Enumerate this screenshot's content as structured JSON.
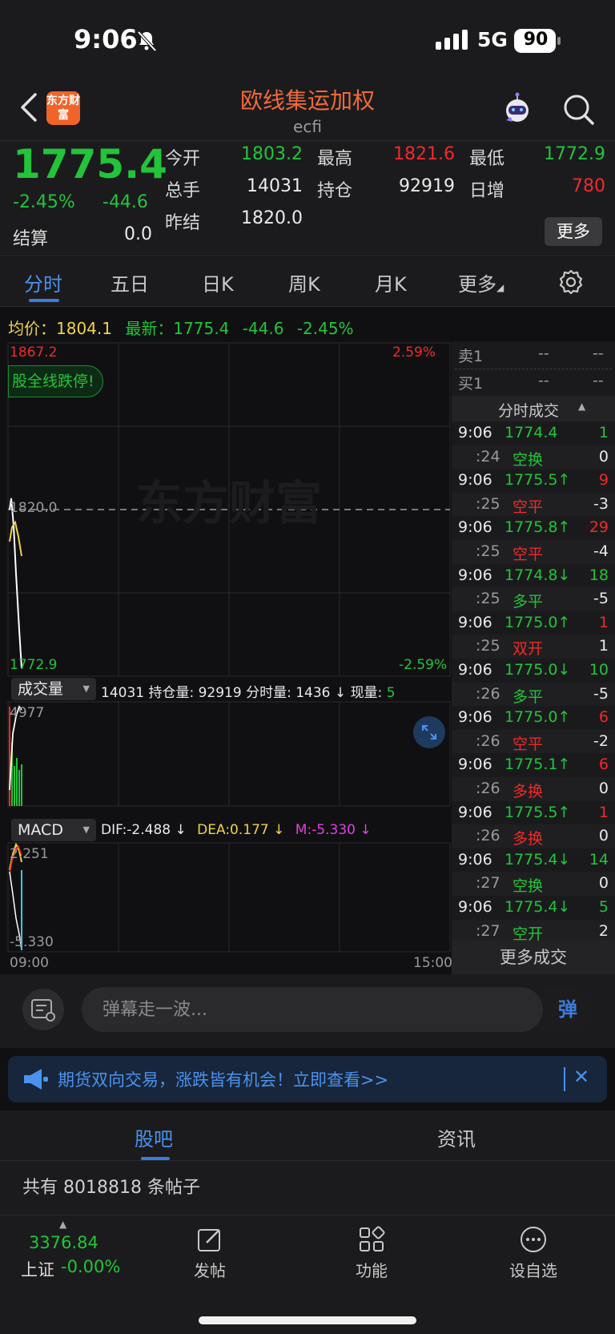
{
  "status": {
    "time": "9:06",
    "network": "5G",
    "battery": "90"
  },
  "header": {
    "title": "欧线集运加权",
    "subtitle": "ecfi",
    "logo_text": "东方财富"
  },
  "quote": {
    "price": "1775.4",
    "change_pct": "-2.45%",
    "change_abs": "-44.6",
    "settle_label": "结算",
    "settle_value": "0.0",
    "open_label": "今开",
    "open_value": "1803.2",
    "volume_label": "总手",
    "volume_value": "14031",
    "prev_settle_label": "昨结",
    "prev_settle_value": "1820.0",
    "high_label": "最高",
    "high_value": "1821.6",
    "oi_label": "持仓",
    "oi_value": "92919",
    "low_label": "最低",
    "low_value": "1772.9",
    "daily_inc_label": "日增",
    "daily_inc_value": "780",
    "more_label": "更多"
  },
  "tabs": [
    "分时",
    "五日",
    "日K",
    "周K",
    "月K",
    "更多"
  ],
  "infoline": {
    "avg_label": "均价：",
    "avg_value": "1804.1",
    "latest_label": "最新：",
    "latest_value": "1775.4",
    "latest_chg": "-44.6",
    "latest_pct": "-2.45%"
  },
  "chart": {
    "price_high": "1867.2",
    "price_mid": "1820.0",
    "price_low": "1772.9",
    "pct_high": "2.59%",
    "pct_low": "-2.59%",
    "watermark": "东方财富",
    "bubble": "股全线跌停!",
    "vol_selector": "成交量",
    "vol_info_1": "14031 持仓量: 92919 分时量: 1436",
    "vol_info_arrow": "↓",
    "vol_info_2": "现量:",
    "vol_info_cur": "5",
    "vol_max": "4977",
    "macd_selector": "MACD",
    "dif": "DIF:-2.488 ↓",
    "dea": "DEA:0.177 ↓",
    "m": "M:-5.330 ↓",
    "macd_high": "2.251",
    "macd_low": "-5.330",
    "time_start": "09:00",
    "time_end": "15:00"
  },
  "book": [
    {
      "label": "卖1",
      "price": "--",
      "vol": "--"
    },
    {
      "label": "买1",
      "price": "--",
      "vol": "--"
    }
  ],
  "trades_title": "分时成交",
  "trades": [
    {
      "t": "9:06",
      "v": "1774.4",
      "vc": "green",
      "n": "1",
      "nc": "green"
    },
    {
      "t": ":24",
      "v": "空换",
      "vc": "green",
      "n": "0",
      "nc": "white"
    },
    {
      "t": "9:06",
      "v": "1775.5↑",
      "vc": "green",
      "n": "9",
      "nc": "red"
    },
    {
      "t": ":25",
      "v": "空平",
      "vc": "red",
      "n": "-3",
      "nc": "white"
    },
    {
      "t": "9:06",
      "v": "1775.8↑",
      "vc": "green",
      "n": "29",
      "nc": "red"
    },
    {
      "t": ":25",
      "v": "空平",
      "vc": "red",
      "n": "-4",
      "nc": "white"
    },
    {
      "t": "9:06",
      "v": "1774.8↓",
      "vc": "green",
      "n": "18",
      "nc": "green"
    },
    {
      "t": ":25",
      "v": "多平",
      "vc": "green",
      "n": "-5",
      "nc": "white"
    },
    {
      "t": "9:06",
      "v": "1775.0↑",
      "vc": "green",
      "n": "1",
      "nc": "red"
    },
    {
      "t": ":25",
      "v": "双开",
      "vc": "red",
      "n": "1",
      "nc": "white"
    },
    {
      "t": "9:06",
      "v": "1775.0↓",
      "vc": "green",
      "n": "10",
      "nc": "green"
    },
    {
      "t": ":26",
      "v": "多平",
      "vc": "green",
      "n": "-5",
      "nc": "white"
    },
    {
      "t": "9:06",
      "v": "1775.0↑",
      "vc": "green",
      "n": "6",
      "nc": "red"
    },
    {
      "t": ":26",
      "v": "空平",
      "vc": "red",
      "n": "-2",
      "nc": "white"
    },
    {
      "t": "9:06",
      "v": "1775.1↑",
      "vc": "green",
      "n": "6",
      "nc": "red"
    },
    {
      "t": ":26",
      "v": "多换",
      "vc": "red",
      "n": "0",
      "nc": "white"
    },
    {
      "t": "9:06",
      "v": "1775.5↑",
      "vc": "green",
      "n": "1",
      "nc": "red"
    },
    {
      "t": ":26",
      "v": "多换",
      "vc": "red",
      "n": "0",
      "nc": "white"
    },
    {
      "t": "9:06",
      "v": "1775.4↓",
      "vc": "green",
      "n": "14",
      "nc": "green"
    },
    {
      "t": ":27",
      "v": "空换",
      "vc": "green",
      "n": "0",
      "nc": "white"
    },
    {
      "t": "9:06",
      "v": "1775.4↓",
      "vc": "green",
      "n": "5",
      "nc": "green"
    },
    {
      "t": ":27",
      "v": "空开",
      "vc": "green",
      "n": "2",
      "nc": "white"
    }
  ],
  "more_trades": "更多成交",
  "danmu": {
    "placeholder": "弹幕走一波...",
    "button": "弹"
  },
  "banner": {
    "text": "期货双向交易，涨跌皆有机会！立即查看>>",
    "close": "✕"
  },
  "guba": {
    "tabs": [
      "股吧",
      "资讯"
    ],
    "post_count": "共有 8018818 条帖子"
  },
  "bottom": {
    "index_value": "3376.84",
    "index_name": "上证",
    "index_change": "-0.00%",
    "nav": [
      "发帖",
      "功能",
      "设自选"
    ]
  }
}
